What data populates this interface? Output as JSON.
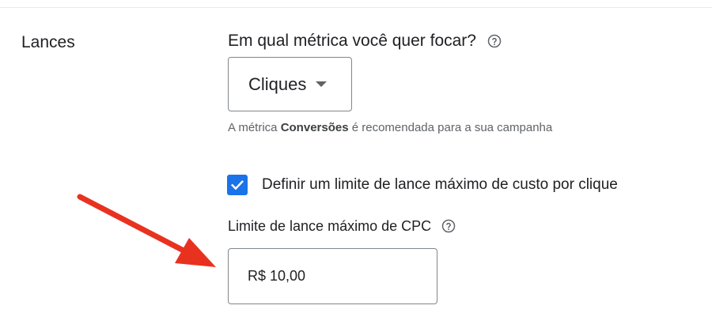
{
  "section": {
    "label": "Lances"
  },
  "metric": {
    "question": "Em qual métrica você quer focar?",
    "selected": "Cliques",
    "hint_prefix": "A métrica ",
    "hint_bold": "Conversões",
    "hint_suffix": " é recomendada para a sua campanha"
  },
  "bid_limit": {
    "checkbox_label": "Definir um limite de lance máximo de custo por clique",
    "checked": true,
    "cpc_label": "Limite de lance máximo de CPC",
    "cpc_value": "R$ 10,00"
  },
  "icons": {
    "help": "help-circle-icon",
    "dropdown": "arrow-drop-down-icon",
    "checkbox": "check-icon",
    "annotation": "red-arrow-annotation"
  },
  "colors": {
    "accent": "#1a73e8",
    "text": "#202124",
    "secondary_text": "#5f6368",
    "border": "#80868b",
    "annotation_arrow": "#e8321f"
  }
}
